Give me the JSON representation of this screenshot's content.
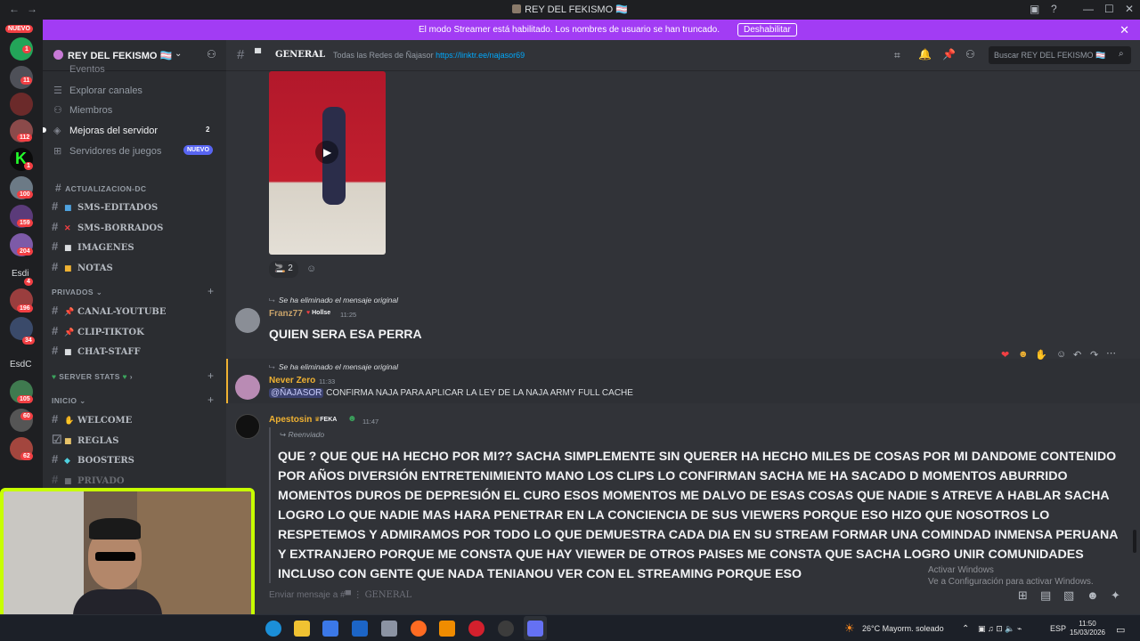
{
  "window": {
    "title": "REY DEL FEKISMO 🏳️‍⚧️"
  },
  "banner": {
    "text": "El modo Streamer está habilitado. Los nombres de usuario se han truncado.",
    "button": "Deshabilitar"
  },
  "rail": {
    "new_badge": "NUEVO",
    "badges": [
      "1",
      "11",
      "112",
      "1",
      "100",
      "159",
      "204",
      "4",
      "196",
      "34",
      "105",
      "60",
      "62"
    ],
    "labels": [
      "Esdi",
      "EsdC"
    ]
  },
  "server": {
    "name": "REY DEL FEKISMO 🏳️‍⚧️"
  },
  "sidebar": {
    "menu": [
      {
        "label": "Eventos"
      },
      {
        "label": "Explorar canales"
      },
      {
        "label": "Miembros"
      },
      {
        "label": "Mejoras del servidor",
        "count": "2"
      },
      {
        "label": "Servidores de juegos",
        "badge": "NUEVO"
      }
    ],
    "cat_actualizacion": "ACTUALIZACION-DC",
    "actualizacion_channels": [
      "SMS-EDITADOS",
      "SMS-BORRADOS",
      "IMAGENES",
      "NOTAS"
    ],
    "cat_privados": "PRIVADOS",
    "privados_channels": [
      "CANAL-YOUTUBE",
      "CLIP-TIKTOK",
      "CHAT-STAFF"
    ],
    "cat_server_stats": "SERVER STATS",
    "cat_inicio": "INICIO",
    "inicio_channels": [
      "WELCOME",
      "REGLAS",
      "BOOSTERS",
      "PRIVADO"
    ]
  },
  "channel": {
    "name": "GENERAL",
    "topic": "Todas las Redes de Ñajasor",
    "link": "https://linktr.ee/najasor69",
    "search_placeholder": "Buscar REY DEL FEKISMO 🏳️‍⚧️"
  },
  "messages": {
    "video_reaction_count": "2",
    "m1": {
      "reply_note": "Se ha eliminado el mensaje original",
      "user": "Franz77",
      "tag": "Hollse",
      "time": "11:25",
      "text": "QUIEN SERA ESA PERRA"
    },
    "m2": {
      "reply_note": "Se ha eliminado el mensaje original",
      "user": "Never Zero",
      "time": "11:33",
      "mention": "@ÑAJASOR",
      "text": "CONFIRMA NAJA PARA APLICAR LA LEY DE LA NAJA ARMY FULL CACHE"
    },
    "m3": {
      "user": "Apestosin",
      "tag": "FEKA",
      "time": "11:47",
      "forwarded": "Reenviado",
      "text": "QUE ? QUE QUE HA HECHO POR MI?? SACHA SIMPLEMENTE SIN QUERER HA HECHO MILES DE COSAS POR MI DANDOME CONTENIDO POR AÑOS DIVERSIÓN ENTRETENIMIENTO MANO LOS CLIPS LO CONFIRMAN SACHA ME HA SACADO D MOMENTOS ABURRIDO MOMENTOS DUROS DE DEPRESIÓN EL CURO ESOS MOMENTOS ME DALVO DE ESAS COSAS QUE NADIE S ATREVE A HABLAR SACHA LOGRO LO QUE NADIE MAS HARA PENETRAR EN LA CONCIENCIA DE SUS VIEWERS PORQUE ESO HIZO QUE NOSOTROS LO RESPETEMOS Y ADMIRAMOS POR TODO LO QUE DEMUESTRA CADA DIA EN SU STREAM FORMAR UNA COMINDAD INMENSA PERUANA Y EXTRANJERO PORQUE ME CONSTA QUE HAY VIEWER DE OTROS PAISES ME CONSTA QUE SACHA LOGRO UNIR COMUNIDADES INCLUSO CON GENTE QUE NADA TENIANOU VER CON EL STREAMING PORQUE ESO"
    }
  },
  "input": {
    "placeholder": "Enviar mensaje a #",
    "channel": "GENERAL"
  },
  "watermark": {
    "line1": "Activar Windows",
    "line2": "Ve a Configuración para activar Windows."
  },
  "taskbar": {
    "weather": "26°C  Mayorm. soleado",
    "lang": "ESP",
    "time": "11:50",
    "date": "15/03/2026"
  },
  "colors": {
    "accent": "#a23cf4",
    "webcam_border": "#c7ff00",
    "link": "#00a8fc"
  }
}
